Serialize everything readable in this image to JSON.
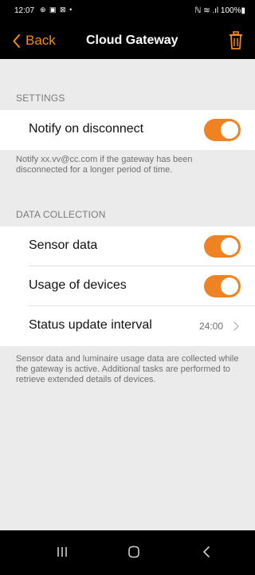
{
  "status_bar": {
    "time": "12:07",
    "left_icons": "⊕ ▣ ⊠ •",
    "right_text": "ℕ ≋ .ıl 100%▮"
  },
  "header": {
    "back_label": "Back",
    "title": "Cloud Gateway",
    "accent_color": "#f08a1c"
  },
  "settings": {
    "header": "SETTINGS",
    "notify_label": "Notify on disconnect",
    "notify_enabled": true,
    "notify_description": "Notify xx.vv@cc.com if the gateway has been disconnected for a longer period of time."
  },
  "data_collection": {
    "header": "DATA COLLECTION",
    "sensor_label": "Sensor data",
    "sensor_enabled": true,
    "usage_label": "Usage of devices",
    "usage_enabled": true,
    "interval_label": "Status update interval",
    "interval_value": "24:00",
    "description": "Sensor data and luminaire usage data are collected while the gateway is active. Additional tasks are performed to retrieve extended details of devices."
  },
  "icons": {
    "back": "chevron-left-icon",
    "trash": "trash-icon",
    "chevron": "chevron-right-icon",
    "recent_apps": "recent-apps-icon",
    "home": "home-icon",
    "system_back": "system-back-icon"
  },
  "colors": {
    "toggle_on": "#ef8222",
    "background": "#ebebeb"
  }
}
